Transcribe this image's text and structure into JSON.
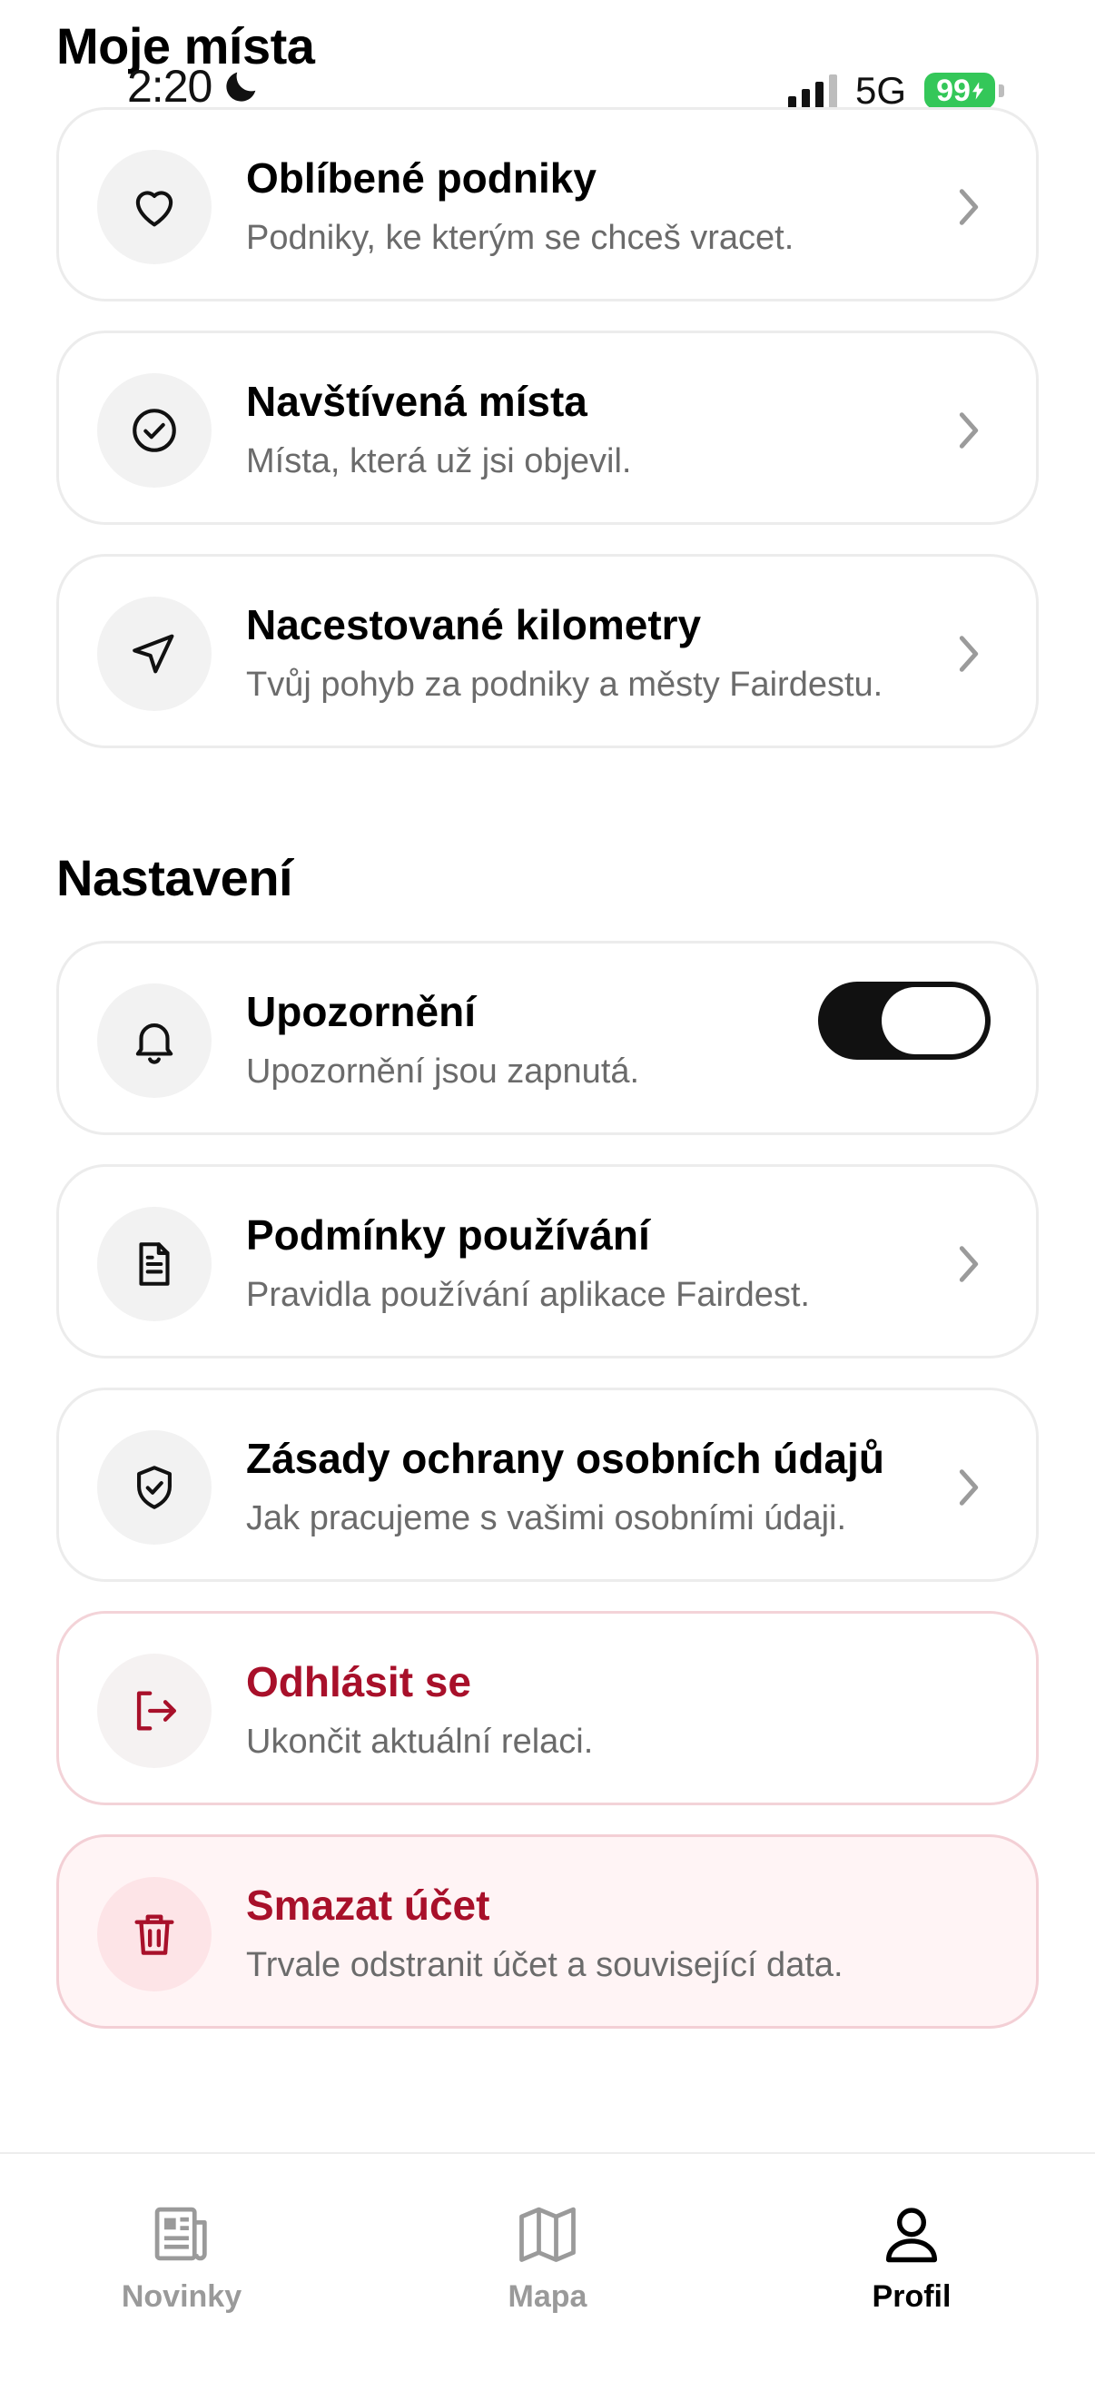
{
  "status_bar": {
    "time": "2:20",
    "network": "5G",
    "battery": "99"
  },
  "sections": {
    "my_places": "Moje místa",
    "settings": "Nastavení"
  },
  "my_places": [
    {
      "title": "Oblíbené podniky",
      "subtitle": "Podniky, ke kterým se chceš vracet.",
      "icon": "heart-icon"
    },
    {
      "title": "Navštívená místa",
      "subtitle": "Místa, která už jsi objevil.",
      "icon": "check-circle-icon"
    },
    {
      "title": "Nacestované kilometry",
      "subtitle": "Tvůj pohyb za podniky a městy Fairdestu.",
      "icon": "navigation-arrow-icon"
    }
  ],
  "settings": [
    {
      "title": "Upozornění",
      "subtitle": "Upozornění jsou zapnutá.",
      "icon": "bell-icon",
      "toggle_on": true
    },
    {
      "title": "Podmínky používání",
      "subtitle": "Pravidla používání aplikace Fairdest.",
      "icon": "document-icon"
    },
    {
      "title": "Zásady ochrany osobních údajů",
      "subtitle": "Jak pracujeme s vašimi osobními údaji.",
      "icon": "shield-check-icon"
    }
  ],
  "account": {
    "logout": {
      "title": "Odhlásit se",
      "subtitle": "Ukončit aktuální relaci.",
      "icon": "logout-icon"
    },
    "delete": {
      "title": "Smazat účet",
      "subtitle": "Trvale odstranit účet a související data.",
      "icon": "trash-icon"
    }
  },
  "tabs": [
    {
      "label": "Novinky",
      "icon": "newspaper-icon",
      "active": false
    },
    {
      "label": "Mapa",
      "icon": "map-icon",
      "active": false
    },
    {
      "label": "Profil",
      "icon": "user-icon",
      "active": true
    }
  ],
  "colors": {
    "danger": "#a8102a",
    "active_toggle": "#111111",
    "battery": "#34c759"
  }
}
